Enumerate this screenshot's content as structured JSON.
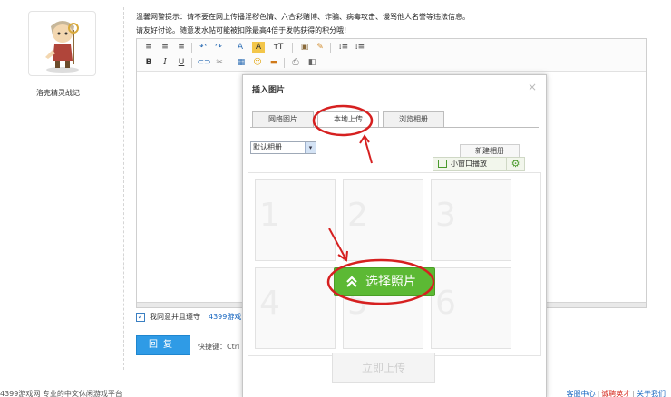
{
  "user": {
    "name": "洛克精灵战记"
  },
  "notices": {
    "line1": "温馨网警提示：请不要在网上传播淫秽色情、六合彩赌博、诈骗、病毒攻击、谩骂他人名誉等违法信息。",
    "line2": "请友好讨论。随意发水帖可能被扣除最高4倍于发帖获得的积分哦!"
  },
  "toolbar": {
    "align_left": "≡",
    "align_center": "≡",
    "align_right": "≡",
    "undo": "↶",
    "redo": "↷",
    "font_color": "A",
    "bg_color": "A",
    "font_size": "тT",
    "paste": "▣",
    "brush": "✎",
    "ordered_list": "⁞≡",
    "unordered_list": "⁞≡",
    "bold": "B",
    "italic": "I",
    "underline": "U",
    "link": "⊂⊃",
    "unlink": "✂",
    "table": "▦",
    "emoji": "☺",
    "image": "▬",
    "preview": "⎙",
    "source": "◧"
  },
  "agree": {
    "text": "我同意并且遵守",
    "link": "4399游戏"
  },
  "reply": {
    "label": "回复",
    "shortcut": "快捷键：Ctrl"
  },
  "footer": {
    "left": "4399游戏网 专业的中文休闲游戏平台",
    "links": [
      "客服中心",
      "诚聘英才",
      "关于我们"
    ]
  },
  "modal": {
    "title": "插入图片",
    "close": "×",
    "tabs": [
      {
        "label": "网络图片",
        "active": false
      },
      {
        "label": "本地上传",
        "active": true
      },
      {
        "label": "浏览相册",
        "active": false
      }
    ],
    "album_select": "默认相册",
    "album_arrow": "▾",
    "new_album": "新建相册",
    "popout": "小窗口播放",
    "gear": "⚙",
    "grid_numbers": [
      "1",
      "2",
      "3",
      "4",
      "5",
      "6"
    ],
    "select_photo": "选择照片",
    "upload_now": "立即上传"
  },
  "colors": {
    "select_green": "#5cb934",
    "reply_blue": "#2f9be6",
    "annotation_red": "#d62020"
  }
}
